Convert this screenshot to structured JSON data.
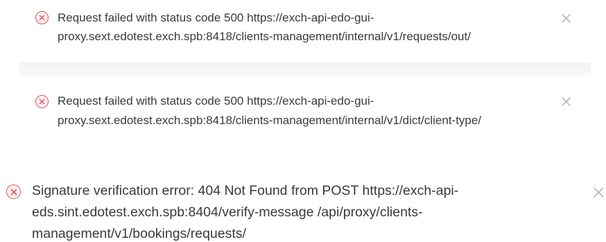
{
  "notifications": [
    {
      "icon": "error-circle-icon",
      "lines": [
        "Request failed with status code 500 https://exch-api-edo-gui-",
        "proxy.sext.edotest.exch.spb:8418/clients-management/internal/v1/requests/out/"
      ]
    },
    {
      "icon": "error-circle-icon",
      "lines": [
        "Request failed with status code 500 https://exch-api-edo-gui-",
        "proxy.sext.edotest.exch.spb:8418/clients-management/internal/v1/dict/client-type/"
      ]
    },
    {
      "icon": "error-circle-icon",
      "lines": [
        "Signature verification error: 404 Not Found from POST https://exch-api-",
        "eds.sint.edotest.exch.spb:8404/verify-message /api/proxy/clients-",
        "management/v1/bookings/requests/"
      ]
    }
  ],
  "colors": {
    "error": "#e8505b",
    "error_bg": "#fff1f1",
    "text": "#3a3a3a",
    "close": "#b5b5b5"
  }
}
